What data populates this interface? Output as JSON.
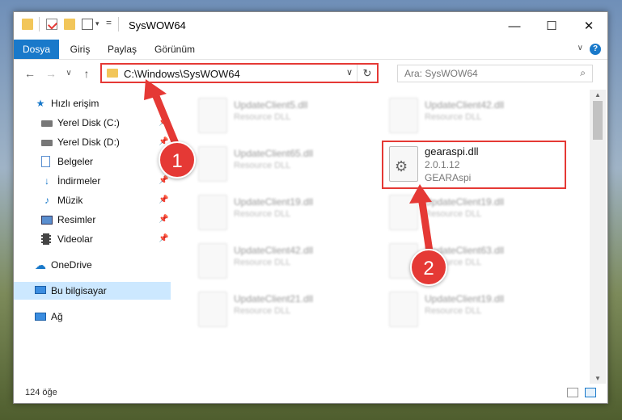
{
  "window": {
    "title": "SysWOW64",
    "controls": {
      "minimize": "—",
      "maximize": "☐",
      "close": "✕"
    }
  },
  "ribbon": {
    "tabs": [
      {
        "label": "Dosya",
        "active": true
      },
      {
        "label": "Giriş",
        "active": false
      },
      {
        "label": "Paylaş",
        "active": false
      },
      {
        "label": "Görünüm",
        "active": false
      }
    ],
    "help": "?"
  },
  "nav": {
    "back": "←",
    "forward": "→",
    "recent": "∨",
    "up": "↑",
    "address": "C:\\Windows\\SysWOW64",
    "dropdown": "∨",
    "refresh": "↻",
    "search_placeholder": "Ara: SysWOW64",
    "search_icon": "⌕"
  },
  "sidebar": {
    "quick_access": "Hızlı erişim",
    "items": [
      {
        "label": "Yerel Disk (C:)",
        "icon": "drive-icon",
        "pinned": true
      },
      {
        "label": "Yerel Disk (D:)",
        "icon": "drive-icon",
        "pinned": true
      },
      {
        "label": "Belgeler",
        "icon": "documents-icon",
        "pinned": true
      },
      {
        "label": "İndirmeler",
        "icon": "download-icon",
        "pinned": true
      },
      {
        "label": "Müzik",
        "icon": "music-icon",
        "pinned": true
      },
      {
        "label": "Resimler",
        "icon": "pictures-icon",
        "pinned": true
      },
      {
        "label": "Videolar",
        "icon": "video-icon",
        "pinned": true
      }
    ],
    "onedrive": "OneDrive",
    "this_pc": "Bu bilgisayar",
    "network": "Ağ"
  },
  "files": [
    {
      "name": "UpdateClient5.dll",
      "desc": "Resource DLL"
    },
    {
      "name": "UpdateClient42.dll",
      "desc": "Resource DLL"
    },
    {
      "name": "UpdateClient65.dll",
      "desc": "Resource DLL"
    },
    {
      "name": "gearaspi.dll",
      "desc": "2.0.1.12",
      "desc2": "GEARAspi",
      "highlighted": true
    },
    {
      "name": "UpdateClient19.dll",
      "desc": "Resource DLL"
    },
    {
      "name": "UpdateClient19.dll",
      "desc": "Resource DLL"
    },
    {
      "name": "UpdateClient42.dll",
      "desc": "Resource DLL"
    },
    {
      "name": "UpdateClient63.dll",
      "desc": "Resource DLL"
    },
    {
      "name": "UpdateClient21.dll",
      "desc": "Resource DLL"
    },
    {
      "name": "UpdateClient19.dll",
      "desc": "Resource DLL"
    }
  ],
  "status": {
    "count": "124 öğe"
  },
  "annotations": {
    "step1": "1",
    "step2": "2"
  },
  "colors": {
    "accent": "#1979ca",
    "highlight": "#e53935",
    "selected": "#cce8ff"
  }
}
